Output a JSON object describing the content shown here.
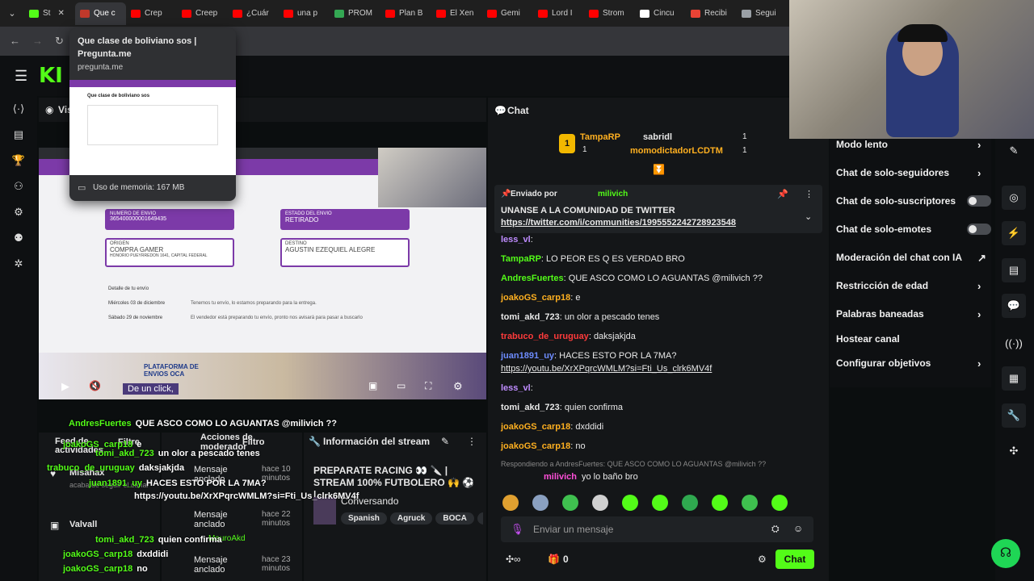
{
  "tabs": [
    {
      "label": "St",
      "color": "#53fc18"
    },
    {
      "label": "Que c",
      "color": "#c0392b"
    },
    {
      "label": "Crep",
      "color": "#ff0000"
    },
    {
      "label": "Creep",
      "color": "#ff0000"
    },
    {
      "label": "¿Cuár",
      "color": "#ff0000"
    },
    {
      "label": "una p",
      "color": "#ff0000"
    },
    {
      "label": "PROM",
      "color": "#34a853"
    },
    {
      "label": "Plan B",
      "color": "#ff0000"
    },
    {
      "label": "El Xen",
      "color": "#ff0000"
    },
    {
      "label": "Gemi",
      "color": "#ff0000"
    },
    {
      "label": "Lord I",
      "color": "#ff0000"
    },
    {
      "label": "Strom",
      "color": "#ff0000"
    },
    {
      "label": "Cincu",
      "color": "#ffffff"
    },
    {
      "label": "Recibi",
      "color": "#ea4335"
    },
    {
      "label": "Segui",
      "color": "#9aa0a6"
    }
  ],
  "hover_card": {
    "title": "Que clase de boliviano sos |",
    "site": "Pregunta.me",
    "url": "pregunta.me",
    "preview_title": "Que clase de boliviano sos",
    "memory": "Uso de memoria: 167 MB"
  },
  "video": {
    "order_number_label": "NUMERO DE ENVIO",
    "order_number": "365400000001649435",
    "status_label": "ESTADO DEL ENVIO",
    "status": "RETIRADO",
    "origin_label": "ORIGEN",
    "origin": "COMPRA GAMER",
    "origin_addr": "HONORIO PUEYRREDON 1641, CAPITAL FEDERAL",
    "dest_label": "DESTINO",
    "dest": "AGUSTIN EZEQUIEL ALEGRE",
    "detail_title": "Detalle de tu envío",
    "row1_date": "Miércoles 03 de diciembre",
    "row1_text": "Tenemos tu envío, lo estamos preparando para la entrega.",
    "row2_date": "Sábado 29 de noviembre",
    "row2_text": "El vendedor está preparando tu envío, pronto nos avisará para pasar a buscarlo",
    "oca": "PLATAFORMA DE ENVIOS OCA",
    "caption": "De un click,"
  },
  "chat": {
    "title": "Chat",
    "gifters": [
      {
        "rank": "1",
        "name": "TampaRP",
        "count": "1"
      },
      {
        "name": "sabridl",
        "count": "1"
      },
      {
        "name": "momodictadorLCDTM",
        "count": "1"
      }
    ],
    "pinned": {
      "by": "Enviado por",
      "user": "milivich",
      "text": "UNANSE A LA COMUNIDAD DE TWITTER",
      "link": "https://twitter.com/i/communities/1995552242728923548"
    },
    "messages": [
      {
        "user": "less_vl",
        "color": "#bf8cff",
        "text": ""
      },
      {
        "user": "TampaRP",
        "color": "#53fc18",
        "text": "LO PEOR ES Q ES VERDAD BRO"
      },
      {
        "user": "AndresFuertes",
        "color": "#53fc18",
        "text": "QUE ASCO COMO LO AGUANTAS @milivich ??"
      },
      {
        "user": "joakoGS_carp18",
        "color": "#ffb020",
        "text": "e"
      },
      {
        "user": "tomi_akd_723",
        "color": "#e8e8e8",
        "text": "un olor a pescado tenes"
      },
      {
        "user": "trabuco_de_uruguay",
        "color": "#ff3b3b",
        "text": "daksjakjda"
      },
      {
        "user": "juan1891_uy",
        "color": "#6d8cff",
        "text": "HACES ESTO POR LA 7MA?"
      },
      {
        "user": "",
        "color": "#fff",
        "text": "https://youtu.be/XrXPqrcWMLM?si=Fti_Us_clrk6MV4f"
      },
      {
        "user": "less_vl",
        "color": "#bf8cff",
        "text": ""
      },
      {
        "user": "tomi_akd_723",
        "color": "#e8e8e8",
        "text": "quien confirma"
      },
      {
        "user": "joakoGS_carp18",
        "color": "#ffb020",
        "text": "dxddidi"
      },
      {
        "user": "joakoGS_carp18",
        "color": "#ffb020",
        "text": "no"
      }
    ],
    "reply_to": "Respondiendo a AndresFuertes: QUE ASCO COMO LO AGUANTAS @milivich ??",
    "reply_user": "milivich",
    "reply_text": "yo lo baño bro",
    "input_placeholder": "Enviar un mensaje",
    "points": "0",
    "send": "Chat"
  },
  "mod_menu": {
    "items": [
      {
        "label": "Modo lento",
        "kind": "chev"
      },
      {
        "label": "Chat de solo-seguidores",
        "kind": "chev"
      },
      {
        "label": "Chat de solo-suscriptores",
        "kind": "toggle"
      },
      {
        "label": "Chat de solo-emotes",
        "kind": "toggle"
      },
      {
        "label": "Moderación del chat con IA",
        "kind": "ext"
      },
      {
        "label": "Restricción de edad",
        "kind": "chev"
      },
      {
        "label": "Palabras baneadas",
        "kind": "chev"
      },
      {
        "label": "Hostear canal",
        "kind": "none"
      },
      {
        "label": "Configurar objetivos",
        "kind": "chev"
      }
    ]
  },
  "dashboard": {
    "visit": "Vis",
    "activity_feed": "Feed de actividades",
    "filter": "Filtre",
    "mod_actions": "Acciones de moderador",
    "mod_filter": "Filtro",
    "stream_info": "Información del stream",
    "feed": [
      {
        "name": "Misahax",
        "sub": "acaba de seguir el canal"
      },
      {
        "name": "Valvall",
        "sub": ""
      }
    ],
    "actions": [
      {
        "label": "Mensaje anclado",
        "by": "Agruck",
        "time": "hace 10 minutos"
      },
      {
        "label": "Mensaje anclado",
        "by": "MauroAkd",
        "time": "hace 22 minutos"
      },
      {
        "label": "Mensaje anclado",
        "by": "",
        "time": "hace 23 minutos"
      }
    ],
    "stream_title": "PREPARATE RACING 👀 🔪 | STREAM 100% FUTBOLERO 🙌 ⚽ |...",
    "category": "Conversando",
    "tags": [
      "Spanish",
      "Agruck",
      "BOCA",
      "E"
    ],
    "overlay_lines": [
      {
        "u": "AndresFuertes",
        "t": "QUE ASCO COMO LO AGUANTAS @milivich ??"
      },
      {
        "u": "joakoGS_carp18",
        "t": "e"
      },
      {
        "u": "tomi_akd_723",
        "t": "un olor a pescado tenes"
      },
      {
        "u": "trabuco_de_uruguay",
        "t": "daksjakjda"
      },
      {
        "u": "juan1891_uy",
        "t": "HACES ESTO POR LA 7MA?"
      },
      {
        "u": "",
        "t": "https://youtu.be/XrXPqrcWMLM?si=Fti_Us_clrk6MV4f"
      },
      {
        "u": "tomi_akd_723",
        "t": "quien confirma"
      },
      {
        "u": "joakoGS_carp18",
        "t": "dxddidi"
      },
      {
        "u": "joakoGS_carp18",
        "t": "no"
      }
    ]
  },
  "colors": {
    "kick_green": "#53fc18",
    "purple": "#7c3aa8"
  }
}
